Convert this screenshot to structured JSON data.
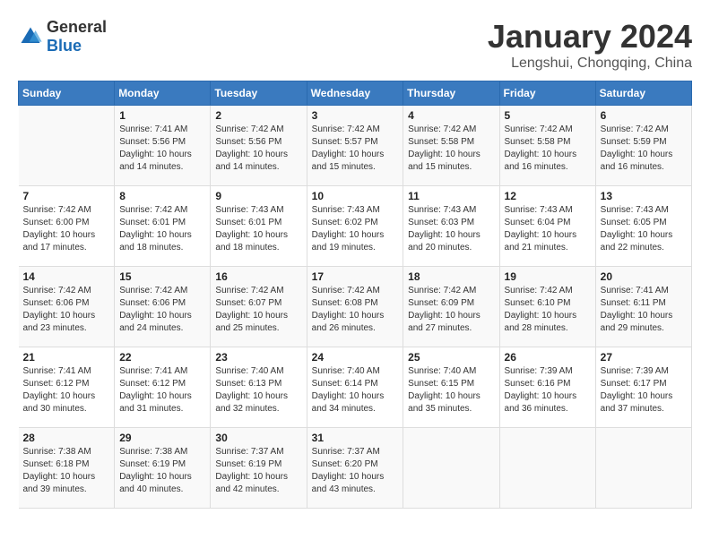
{
  "header": {
    "logo_general": "General",
    "logo_blue": "Blue",
    "title": "January 2024",
    "location": "Lengshui, Chongqing, China"
  },
  "columns": [
    "Sunday",
    "Monday",
    "Tuesday",
    "Wednesday",
    "Thursday",
    "Friday",
    "Saturday"
  ],
  "weeks": [
    [
      {
        "day": "",
        "detail": ""
      },
      {
        "day": "1",
        "detail": "Sunrise: 7:41 AM\nSunset: 5:56 PM\nDaylight: 10 hours\nand 14 minutes."
      },
      {
        "day": "2",
        "detail": "Sunrise: 7:42 AM\nSunset: 5:56 PM\nDaylight: 10 hours\nand 14 minutes."
      },
      {
        "day": "3",
        "detail": "Sunrise: 7:42 AM\nSunset: 5:57 PM\nDaylight: 10 hours\nand 15 minutes."
      },
      {
        "day": "4",
        "detail": "Sunrise: 7:42 AM\nSunset: 5:58 PM\nDaylight: 10 hours\nand 15 minutes."
      },
      {
        "day": "5",
        "detail": "Sunrise: 7:42 AM\nSunset: 5:58 PM\nDaylight: 10 hours\nand 16 minutes."
      },
      {
        "day": "6",
        "detail": "Sunrise: 7:42 AM\nSunset: 5:59 PM\nDaylight: 10 hours\nand 16 minutes."
      }
    ],
    [
      {
        "day": "7",
        "detail": "Sunrise: 7:42 AM\nSunset: 6:00 PM\nDaylight: 10 hours\nand 17 minutes."
      },
      {
        "day": "8",
        "detail": "Sunrise: 7:42 AM\nSunset: 6:01 PM\nDaylight: 10 hours\nand 18 minutes."
      },
      {
        "day": "9",
        "detail": "Sunrise: 7:43 AM\nSunset: 6:01 PM\nDaylight: 10 hours\nand 18 minutes."
      },
      {
        "day": "10",
        "detail": "Sunrise: 7:43 AM\nSunset: 6:02 PM\nDaylight: 10 hours\nand 19 minutes."
      },
      {
        "day": "11",
        "detail": "Sunrise: 7:43 AM\nSunset: 6:03 PM\nDaylight: 10 hours\nand 20 minutes."
      },
      {
        "day": "12",
        "detail": "Sunrise: 7:43 AM\nSunset: 6:04 PM\nDaylight: 10 hours\nand 21 minutes."
      },
      {
        "day": "13",
        "detail": "Sunrise: 7:43 AM\nSunset: 6:05 PM\nDaylight: 10 hours\nand 22 minutes."
      }
    ],
    [
      {
        "day": "14",
        "detail": "Sunrise: 7:42 AM\nSunset: 6:06 PM\nDaylight: 10 hours\nand 23 minutes."
      },
      {
        "day": "15",
        "detail": "Sunrise: 7:42 AM\nSunset: 6:06 PM\nDaylight: 10 hours\nand 24 minutes."
      },
      {
        "day": "16",
        "detail": "Sunrise: 7:42 AM\nSunset: 6:07 PM\nDaylight: 10 hours\nand 25 minutes."
      },
      {
        "day": "17",
        "detail": "Sunrise: 7:42 AM\nSunset: 6:08 PM\nDaylight: 10 hours\nand 26 minutes."
      },
      {
        "day": "18",
        "detail": "Sunrise: 7:42 AM\nSunset: 6:09 PM\nDaylight: 10 hours\nand 27 minutes."
      },
      {
        "day": "19",
        "detail": "Sunrise: 7:42 AM\nSunset: 6:10 PM\nDaylight: 10 hours\nand 28 minutes."
      },
      {
        "day": "20",
        "detail": "Sunrise: 7:41 AM\nSunset: 6:11 PM\nDaylight: 10 hours\nand 29 minutes."
      }
    ],
    [
      {
        "day": "21",
        "detail": "Sunrise: 7:41 AM\nSunset: 6:12 PM\nDaylight: 10 hours\nand 30 minutes."
      },
      {
        "day": "22",
        "detail": "Sunrise: 7:41 AM\nSunset: 6:12 PM\nDaylight: 10 hours\nand 31 minutes."
      },
      {
        "day": "23",
        "detail": "Sunrise: 7:40 AM\nSunset: 6:13 PM\nDaylight: 10 hours\nand 32 minutes."
      },
      {
        "day": "24",
        "detail": "Sunrise: 7:40 AM\nSunset: 6:14 PM\nDaylight: 10 hours\nand 34 minutes."
      },
      {
        "day": "25",
        "detail": "Sunrise: 7:40 AM\nSunset: 6:15 PM\nDaylight: 10 hours\nand 35 minutes."
      },
      {
        "day": "26",
        "detail": "Sunrise: 7:39 AM\nSunset: 6:16 PM\nDaylight: 10 hours\nand 36 minutes."
      },
      {
        "day": "27",
        "detail": "Sunrise: 7:39 AM\nSunset: 6:17 PM\nDaylight: 10 hours\nand 37 minutes."
      }
    ],
    [
      {
        "day": "28",
        "detail": "Sunrise: 7:38 AM\nSunset: 6:18 PM\nDaylight: 10 hours\nand 39 minutes."
      },
      {
        "day": "29",
        "detail": "Sunrise: 7:38 AM\nSunset: 6:19 PM\nDaylight: 10 hours\nand 40 minutes."
      },
      {
        "day": "30",
        "detail": "Sunrise: 7:37 AM\nSunset: 6:19 PM\nDaylight: 10 hours\nand 42 minutes."
      },
      {
        "day": "31",
        "detail": "Sunrise: 7:37 AM\nSunset: 6:20 PM\nDaylight: 10 hours\nand 43 minutes."
      },
      {
        "day": "",
        "detail": ""
      },
      {
        "day": "",
        "detail": ""
      },
      {
        "day": "",
        "detail": ""
      }
    ]
  ]
}
